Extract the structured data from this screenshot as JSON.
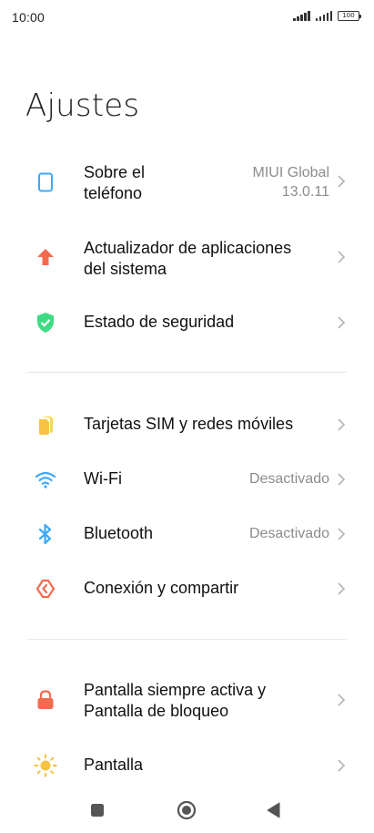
{
  "status_bar": {
    "time": "10:00",
    "battery": "100",
    "icons": [
      "signal-icon",
      "signal-icon",
      "battery-icon"
    ]
  },
  "page": {
    "title": "Ajustes"
  },
  "sections": [
    {
      "items": [
        {
          "label_line1": "Sobre el",
          "label_line2": "teléfono",
          "value_line1": "MIUI Global",
          "value_line2": "13.0.11",
          "icon": "phone-icon",
          "icon_color": "#3fa9f5"
        },
        {
          "label_line1": "Actualizador de aplicaciones",
          "label_line2": "del sistema",
          "icon": "update-arrow-icon",
          "icon_color": "#f26b4f"
        },
        {
          "label_line1": "Estado de seguridad",
          "icon": "shield-check-icon",
          "icon_color": "#3ddc84"
        }
      ]
    },
    {
      "items": [
        {
          "label_line1": "Tarjetas SIM y redes móviles",
          "icon": "sim-card-icon",
          "icon_color": "#f6c343"
        },
        {
          "label_line1": "Wi-Fi",
          "value_line1": "Desactivado",
          "icon": "wifi-icon",
          "icon_color": "#3fa9f5"
        },
        {
          "label_line1": "Bluetooth",
          "value_line1": "Desactivado",
          "icon": "bluetooth-icon",
          "icon_color": "#3fa9f5"
        },
        {
          "label_line1": "Conexión y compartir",
          "icon": "share-connection-icon",
          "icon_color": "#f26b4f"
        }
      ]
    },
    {
      "items": [
        {
          "label_line1": "Pantalla siempre activa y",
          "label_line2": "Pantalla de bloqueo",
          "icon": "lock-icon",
          "icon_color": "#f26b4f"
        },
        {
          "label_line1": "Pantalla",
          "icon": "sun-icon",
          "icon_color": "#f6c343"
        }
      ]
    }
  ],
  "nav_bar": {
    "buttons": [
      "recents-square-icon",
      "home-circle-icon",
      "back-triangle-icon"
    ]
  }
}
